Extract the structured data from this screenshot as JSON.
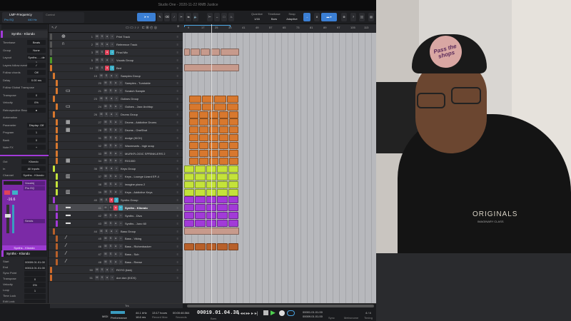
{
  "window": {
    "title": "Studio One - 2020-11-22 RMB Justice"
  },
  "toolbar": {
    "channel_name": "LMF-Frequency",
    "preset": "Pro EQ",
    "preset_value": "440 Hz",
    "control_label": "Control",
    "quantize_label": "Quantize",
    "quantize_value": "1/16",
    "timebase_label": "Timebase",
    "timebase_value": "Bars",
    "snap_label": "Snap",
    "snap_value": "Adaptive",
    "help": "?"
  },
  "ruler": {
    "ticks": [
      "9",
      "17",
      "25",
      "33",
      "41",
      "49",
      "57",
      "65",
      "73",
      "81",
      "89",
      "97",
      "105",
      "113"
    ]
  },
  "inspector": {
    "track_name": "Synths - Kliondo",
    "rows": [
      {
        "label": "Timebase",
        "value": "Beats"
      },
      {
        "label": "Group",
        "value": "None"
      },
      {
        "label": "Layout",
        "value": "Synths - ...de 1"
      },
      {
        "label": "Layers follow events",
        "value": "✓"
      },
      {
        "label": "Follow chords",
        "value": "Off"
      },
      {
        "label": "Delay",
        "value": "0.00 ms"
      },
      {
        "label": "Follow Global Transpose",
        "value": ""
      },
      {
        "label": "Transpose",
        "value": "0"
      },
      {
        "label": "Velocity",
        "value": "0%"
      },
      {
        "label": "Retrospective Recording",
        "value": "●"
      },
      {
        "label": "Automation",
        "value": ""
      },
      {
        "label": "Parameter",
        "value": "Display: Off"
      },
      {
        "label": "Program",
        "value": "1"
      },
      {
        "label": "Bank",
        "value": "0"
      },
      {
        "label": "Note FX",
        "value": "+"
      }
    ],
    "routing": [
      {
        "label": "Out",
        "value": "Kliondo"
      },
      {
        "label": "In",
        "value": "All Inputs"
      },
      {
        "label": "Channel",
        "value": "Synths - Kliondo"
      }
    ],
    "inserts": [
      "Vocalnj",
      "Pro EQ"
    ],
    "sends": [
      "Sends"
    ],
    "fader_value": "-16.6",
    "channel_strip_label": "Synths - Kliondo",
    "event_title": "Synths - Kliondo",
    "event_rows": [
      {
        "label": "Start",
        "value": "00009.01.01.00"
      },
      {
        "label": "End",
        "value": "00013.01.01.00"
      },
      {
        "label": "Sync Point",
        "value": ""
      },
      {
        "label": "Transpose",
        "value": "0"
      },
      {
        "label": "Velocity",
        "value": "0%"
      },
      {
        "label": "Loop",
        "value": "1"
      },
      {
        "label": "Time Lock",
        "value": ""
      },
      {
        "label": "Edit Lock",
        "value": ""
      }
    ]
  },
  "tracks": [
    {
      "num": "1",
      "name": "Print Track",
      "color": "#555",
      "indent": 0,
      "icon": "globe"
    },
    {
      "num": "2",
      "name": "Reference Track",
      "color": "#555",
      "indent": 0,
      "icon": "headphones"
    },
    {
      "num": "3",
      "name": "Final Mix",
      "color": "#555",
      "indent": 0,
      "rec": true
    },
    {
      "num": "5",
      "name": "Vocals Group",
      "color": "#4c9a2a",
      "indent": 0
    },
    {
      "num": "14",
      "name": "Bed",
      "color": "#d8782e",
      "indent": 0,
      "rec": true
    },
    {
      "num": "15",
      "name": "Samples Group",
      "color": "#d8782e",
      "indent": 1
    },
    {
      "num": "20",
      "name": "Samples - Turntable",
      "color": "#d8782e",
      "indent": 2
    },
    {
      "num": "21",
      "name": "Scratch Sample",
      "color": "#d8782e",
      "indent": 2,
      "icon": "sampler"
    },
    {
      "num": "23",
      "name": "Guitars Group",
      "color": "#d8782e",
      "indent": 1
    },
    {
      "num": "24",
      "name": "Guitars - Jazz Archtop",
      "color": "#d8782e",
      "indent": 2,
      "icon": "sampler"
    },
    {
      "num": "26",
      "name": "Drums Group",
      "color": "#d8782e",
      "indent": 1
    },
    {
      "num": "27",
      "name": "Drums - Addictive Drums",
      "color": "#d8782e",
      "indent": 2,
      "icon": "drum"
    },
    {
      "num": "28",
      "name": "Drums - OneShot",
      "color": "#d8782e",
      "indent": 2,
      "icon": "drum"
    },
    {
      "num": "31",
      "name": "dodge (KICK)",
      "color": "#d8782e",
      "indent": 2
    },
    {
      "num": "32",
      "name": "Wavemarts - high snap",
      "color": "#d8782e",
      "indent": 2
    },
    {
      "num": "33",
      "name": "MURKFLOGIC SPRINKLERS 2",
      "color": "#d8782e",
      "indent": 2
    },
    {
      "num": "34",
      "name": "RX1000",
      "color": "#d8782e",
      "indent": 2,
      "icon": "drum"
    },
    {
      "num": "36",
      "name": "Keys Group",
      "color": "#c4e33a",
      "indent": 1
    },
    {
      "num": "37",
      "name": "Keys - Lounge Lizard EP-4",
      "color": "#c4e33a",
      "indent": 2,
      "icon": "keys"
    },
    {
      "num": "38",
      "name": "imagine piano 2",
      "color": "#c4e33a",
      "indent": 2
    },
    {
      "num": "39",
      "name": "Keys - Addictive Keys",
      "color": "#c4e33a",
      "indent": 2,
      "icon": "keys"
    },
    {
      "num": "40",
      "name": "Synths Group",
      "color": "#a23ad8",
      "indent": 1,
      "rec": true
    },
    {
      "num": "41",
      "name": "Synths - Kliondo",
      "color": "#a23ad8",
      "indent": 2,
      "icon": "synth",
      "rec": true,
      "selected": true
    },
    {
      "num": "42",
      "name": "Synths - Diva",
      "color": "#a23ad8",
      "indent": 2,
      "icon": "synth"
    },
    {
      "num": "43",
      "name": "Synths - Juno 60",
      "color": "#a23ad8",
      "indent": 2,
      "icon": "synth"
    },
    {
      "num": "44",
      "name": "Bass Group",
      "color": "#b8602a",
      "indent": 1
    },
    {
      "num": "45",
      "name": "Bass - Viking",
      "color": "#b8602a",
      "indent": 2,
      "icon": "guitar"
    },
    {
      "num": "46",
      "name": "Bass - Richenbacker",
      "color": "#b8602a",
      "indent": 2,
      "icon": "guitar"
    },
    {
      "num": "47",
      "name": "Bass - Sub",
      "color": "#b8602a",
      "indent": 2,
      "icon": "guitar"
    },
    {
      "num": "48",
      "name": "Bass - Reese",
      "color": "#b8602a",
      "indent": 2,
      "icon": "guitar"
    },
    {
      "num": "50",
      "name": "RO?O (kick)",
      "color": "#d06a2a",
      "indent": 0
    },
    {
      "num": "51",
      "name": "don don (KICK)",
      "color": "#d06a2a",
      "indent": 0
    }
  ],
  "track_list_footer": "Trk",
  "transport": {
    "midi_label": "MIDI",
    "performance_label": "Performance",
    "sample_rate": "44.1 kHz",
    "latency": "18.6 ms",
    "record_time": "13:17 hours",
    "record_label": "Record Max",
    "seconds": "00:00:46.564",
    "seconds_label": "Seconds",
    "position": "00019.01.04.38",
    "position_label": "Bars",
    "loop_start": "00001.01.01.00",
    "loop_end": "00009.01.01.00",
    "sync_label": "Sync",
    "metronome_label": "Metronome",
    "time_sig": "4 / 4",
    "timing_label": "Timing"
  },
  "webcam": {
    "hoodie_text": "ORIGINALS",
    "hoodie_subtext": "IMAGINARY CLASS",
    "cap_text": "Pass the shops"
  }
}
